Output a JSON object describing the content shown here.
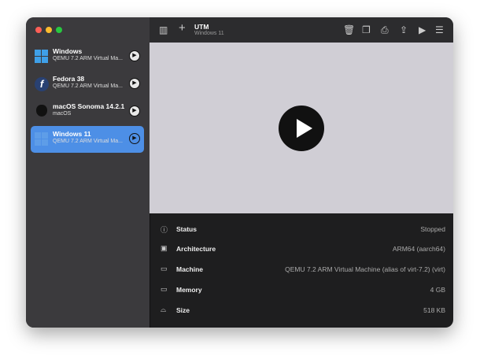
{
  "toolbar": {
    "title": "UTM",
    "subtitle": "Windows 11"
  },
  "sidebar": {
    "items": [
      {
        "name": "Windows",
        "subtitle": "QEMU 7.2 ARM Virtual Ma...",
        "icon": "windows-icon"
      },
      {
        "name": "Fedora 38",
        "subtitle": "QEMU 7.2 ARM Virtual Ma...",
        "icon": "fedora-icon"
      },
      {
        "name": "macOS Sonoma 14.2.1",
        "subtitle": "macOS",
        "icon": "apple-icon"
      },
      {
        "name": "Windows 11",
        "subtitle": "QEMU 7.2 ARM Virtual Ma...",
        "icon": "windows-icon",
        "selected": true
      }
    ]
  },
  "details": [
    {
      "label": "Status",
      "value": "Stopped"
    },
    {
      "label": "Architecture",
      "value": "ARM64 (aarch64)"
    },
    {
      "label": "Machine",
      "value": "QEMU 7.2 ARM Virtual Machine (alias of virt-7.2) (virt)"
    },
    {
      "label": "Memory",
      "value": "4 GB"
    },
    {
      "label": "Size",
      "value": "518 KB"
    }
  ],
  "colors": {
    "accent": "#4d8fe6",
    "preview": "#d0ced5"
  }
}
